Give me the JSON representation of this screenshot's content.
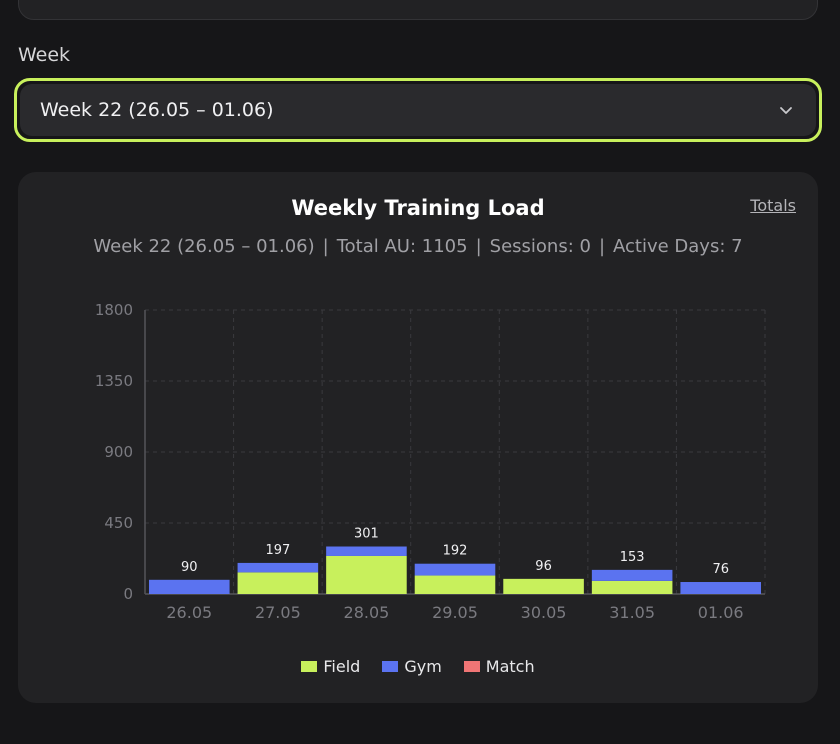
{
  "week_label": "Week",
  "week_select": {
    "value": "Week 22 (26.05 – 01.06)"
  },
  "card": {
    "totals_link": "Totals",
    "subtitle": {
      "week": "Week 22 (26.05 – 01.06)",
      "total": "Total AU: 1105",
      "sessions": "Sessions: 0",
      "active_days": "Active Days: 7",
      "separator": "|"
    }
  },
  "colors": {
    "field": "#c8f05c",
    "gym": "#5b73f0",
    "match": "#f07575",
    "accent": "#c8f05c"
  },
  "chart_data": {
    "type": "bar",
    "stacked": true,
    "title": "Weekly Training Load",
    "categories": [
      "26.05",
      "27.05",
      "28.05",
      "29.05",
      "30.05",
      "31.05",
      "01.06"
    ],
    "series": [
      {
        "name": "Field",
        "values": [
          0,
          137,
          241,
          117,
          96,
          83,
          0
        ]
      },
      {
        "name": "Gym",
        "values": [
          90,
          60,
          60,
          75,
          0,
          70,
          76
        ]
      },
      {
        "name": "Match",
        "values": [
          0,
          0,
          0,
          0,
          0,
          0,
          0
        ]
      }
    ],
    "totals": [
      90,
      197,
      301,
      192,
      96,
      153,
      76
    ],
    "yticks": [
      0,
      450,
      900,
      1350,
      1800
    ],
    "ylim": [
      0,
      1800
    ],
    "grid": true,
    "legend": "bottom"
  }
}
